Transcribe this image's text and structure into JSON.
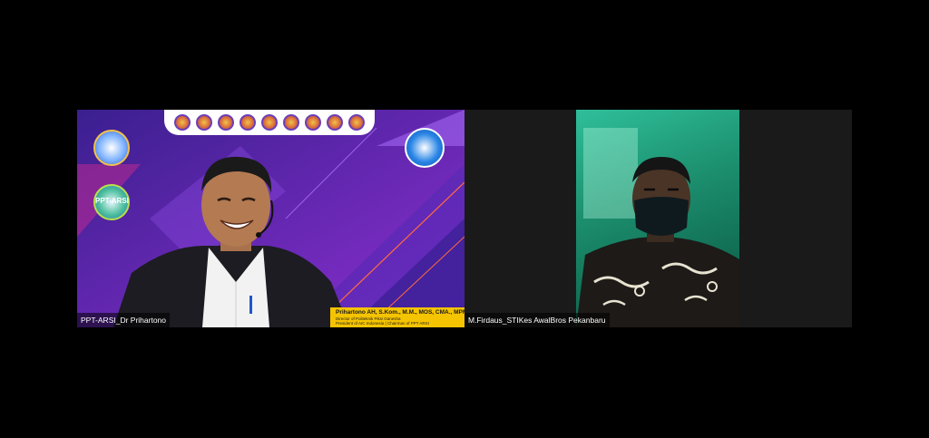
{
  "participants": [
    {
      "id": "p1",
      "name": "PPT-ARSI_Dr Prihartono",
      "side_logo_text": "PPT-ARSI",
      "banner": {
        "line1": "Prihartono AH, S.Kom., M.M., MOS, CMA., MPM.",
        "line2": "Director of Politeknik Piksi Ganesha",
        "line3": "President of AIC Indonesia | Chairman of PPT ARSI"
      }
    },
    {
      "id": "p2",
      "name": "M.Firdaus_STIKes AwalBros Pekanbaru"
    }
  ],
  "colors": {
    "background": "#000000",
    "tile2_bg": "#1a1a1a",
    "banner": "#f5c400",
    "backdrop_purple": "#7a2fc9"
  }
}
